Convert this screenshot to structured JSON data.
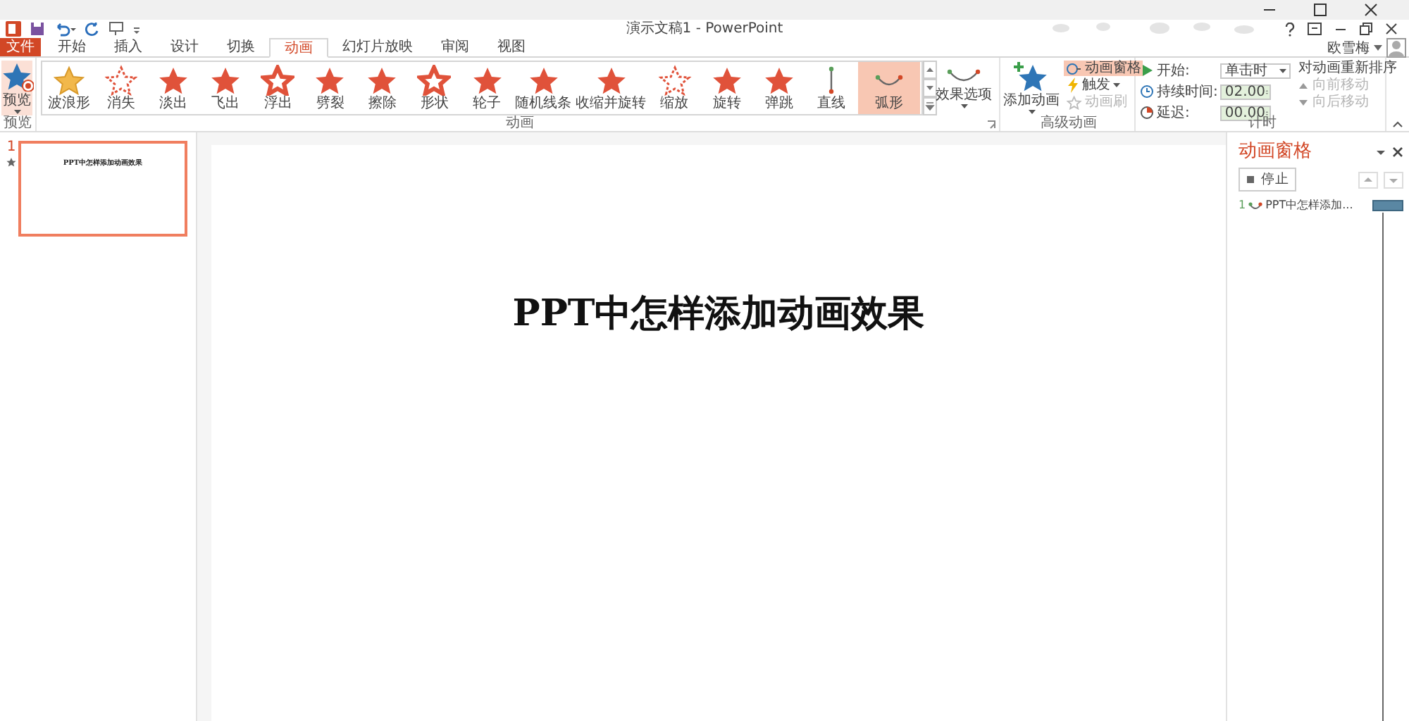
{
  "window": {
    "title": "演示文稿1 - PowerPoint",
    "user": "欧雪梅"
  },
  "file_tab": "文件",
  "tabs": [
    {
      "label": "开始",
      "selected": false
    },
    {
      "label": "插入",
      "selected": false
    },
    {
      "label": "设计",
      "selected": false
    },
    {
      "label": "切换",
      "selected": false
    },
    {
      "label": "动画",
      "selected": true
    },
    {
      "label": "幻灯片放映",
      "selected": false
    },
    {
      "label": "审阅",
      "selected": false
    },
    {
      "label": "视图",
      "selected": false
    }
  ],
  "ribbon": {
    "preview": {
      "button": "预览",
      "label": "预览"
    },
    "animations": {
      "label": "动画",
      "effects": [
        {
          "label": "波浪形",
          "kind": "gold-star",
          "selected": false
        },
        {
          "label": "消失",
          "kind": "burst",
          "selected": false
        },
        {
          "label": "淡出",
          "kind": "star",
          "selected": false
        },
        {
          "label": "飞出",
          "kind": "star",
          "selected": false
        },
        {
          "label": "浮出",
          "kind": "outline-star",
          "selected": false
        },
        {
          "label": "劈裂",
          "kind": "star",
          "selected": false
        },
        {
          "label": "擦除",
          "kind": "star",
          "selected": false
        },
        {
          "label": "形状",
          "kind": "outline-star",
          "selected": false
        },
        {
          "label": "轮子",
          "kind": "star",
          "selected": false
        },
        {
          "label": "随机线条",
          "kind": "star",
          "selected": false
        },
        {
          "label": "收缩并旋转",
          "kind": "star",
          "selected": false
        },
        {
          "label": "缩放",
          "kind": "burst",
          "selected": false
        },
        {
          "label": "旋转",
          "kind": "star",
          "selected": false
        },
        {
          "label": "弹跳",
          "kind": "star",
          "selected": false
        },
        {
          "label": "直线",
          "kind": "line",
          "selected": false
        },
        {
          "label": "弧形",
          "kind": "arc",
          "selected": true
        }
      ],
      "effect_options": "效果选项"
    },
    "advanced": {
      "label": "高级动画",
      "add": "添加动画",
      "pane": {
        "label": "动画窗格",
        "selected": true
      },
      "trigger": "触发",
      "painter": {
        "label": "动画刷",
        "disabled": true
      }
    },
    "timing": {
      "label": "计时",
      "start_label": "开始:",
      "start_value": "单击时",
      "duration_label": "持续时间:",
      "duration": "02.00",
      "delay_label": "延迟:",
      "delay": "00.00",
      "reorder": "对动画重新排序",
      "moves": [
        {
          "label": "向前移动",
          "disabled": true
        },
        {
          "label": "向后移动",
          "disabled": true
        }
      ]
    }
  },
  "slides": [
    {
      "number": "1",
      "title": "PPT中怎样添加动画效果",
      "selected": true
    }
  ],
  "slide": {
    "title": "PPT中怎样添加动画效果"
  },
  "animation_pane": {
    "title": "动画窗格",
    "play": "停止",
    "items": [
      {
        "number": "1",
        "label": "PPT中怎样添加..."
      }
    ]
  }
}
